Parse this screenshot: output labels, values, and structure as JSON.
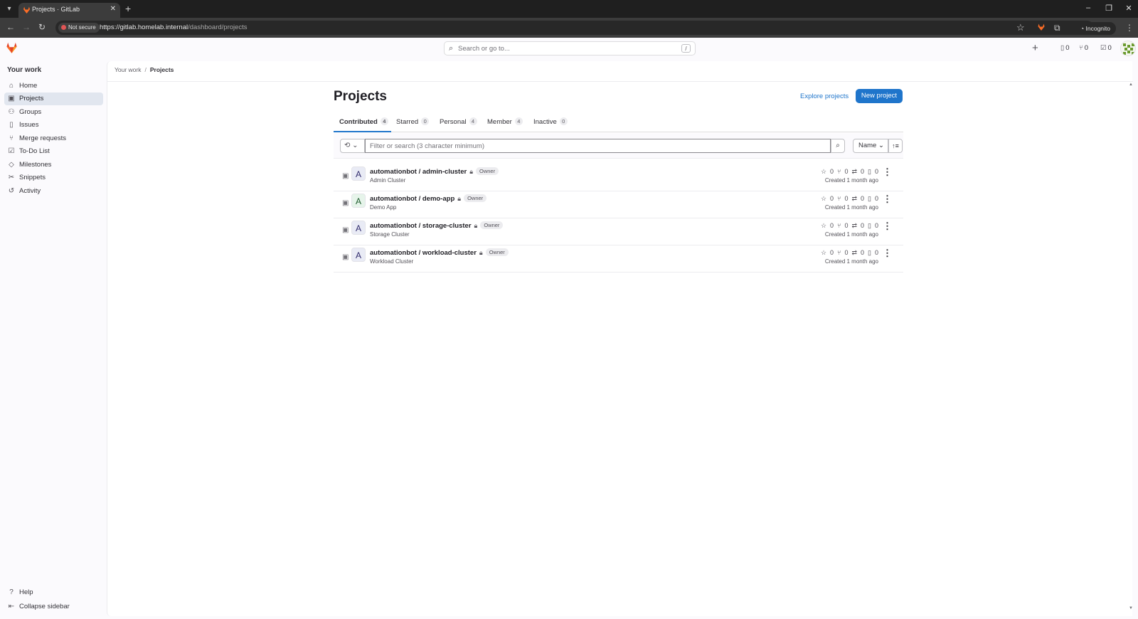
{
  "browser": {
    "tab_title": "Projects · GitLab",
    "not_secure": "Not secure",
    "url_host": "https://gitlab.homelab.internal",
    "url_path": "/dashboard/projects",
    "incognito": "Incognito"
  },
  "topbar": {
    "search_placeholder": "Search or go to...",
    "search_shortcut": "/",
    "issues_count": "0",
    "mr_count": "0",
    "todo_count": "0"
  },
  "sidebar": {
    "title": "Your work",
    "items": [
      {
        "label": "Home",
        "icon": "home-icon"
      },
      {
        "label": "Projects",
        "icon": "project-icon"
      },
      {
        "label": "Groups",
        "icon": "group-icon"
      },
      {
        "label": "Issues",
        "icon": "issues-icon"
      },
      {
        "label": "Merge requests",
        "icon": "merge-request-icon"
      },
      {
        "label": "To-Do List",
        "icon": "todo-icon"
      },
      {
        "label": "Milestones",
        "icon": "milestone-icon"
      },
      {
        "label": "Snippets",
        "icon": "snippet-icon"
      },
      {
        "label": "Activity",
        "icon": "activity-icon"
      }
    ],
    "help": "Help",
    "collapse": "Collapse sidebar"
  },
  "breadcrumb": {
    "parent": "Your work",
    "current": "Projects"
  },
  "page": {
    "title": "Projects",
    "explore_label": "Explore projects",
    "new_project_label": "New project"
  },
  "tabs": [
    {
      "label": "Contributed",
      "count": "4"
    },
    {
      "label": "Starred",
      "count": "0"
    },
    {
      "label": "Personal",
      "count": "4"
    },
    {
      "label": "Member",
      "count": "4"
    },
    {
      "label": "Inactive",
      "count": "0"
    }
  ],
  "filter": {
    "placeholder": "Filter or search (3 character minimum)",
    "sort_label": "Name"
  },
  "projects": [
    {
      "avatar": "A",
      "name": "automationbot / admin-cluster",
      "role": "Owner",
      "description": "Admin Cluster",
      "stars": "0",
      "forks": "0",
      "mrs": "0",
      "issues": "0",
      "created": "Created 1 month ago"
    },
    {
      "avatar": "A",
      "name": "automationbot / demo-app",
      "role": "Owner",
      "description": "Demo App",
      "stars": "0",
      "forks": "0",
      "mrs": "0",
      "issues": "0",
      "created": "Created 1 month ago"
    },
    {
      "avatar": "A",
      "name": "automationbot / storage-cluster",
      "role": "Owner",
      "description": "Storage Cluster",
      "stars": "0",
      "forks": "0",
      "mrs": "0",
      "issues": "0",
      "created": "Created 1 month ago"
    },
    {
      "avatar": "A",
      "name": "automationbot / workload-cluster",
      "role": "Owner",
      "description": "Workload Cluster",
      "stars": "0",
      "forks": "0",
      "mrs": "0",
      "issues": "0",
      "created": "Created 1 month ago"
    }
  ],
  "colors": {
    "accent": "#1f75cb",
    "active_nav": "#e1e6ef",
    "brand": "#fc6d26"
  }
}
